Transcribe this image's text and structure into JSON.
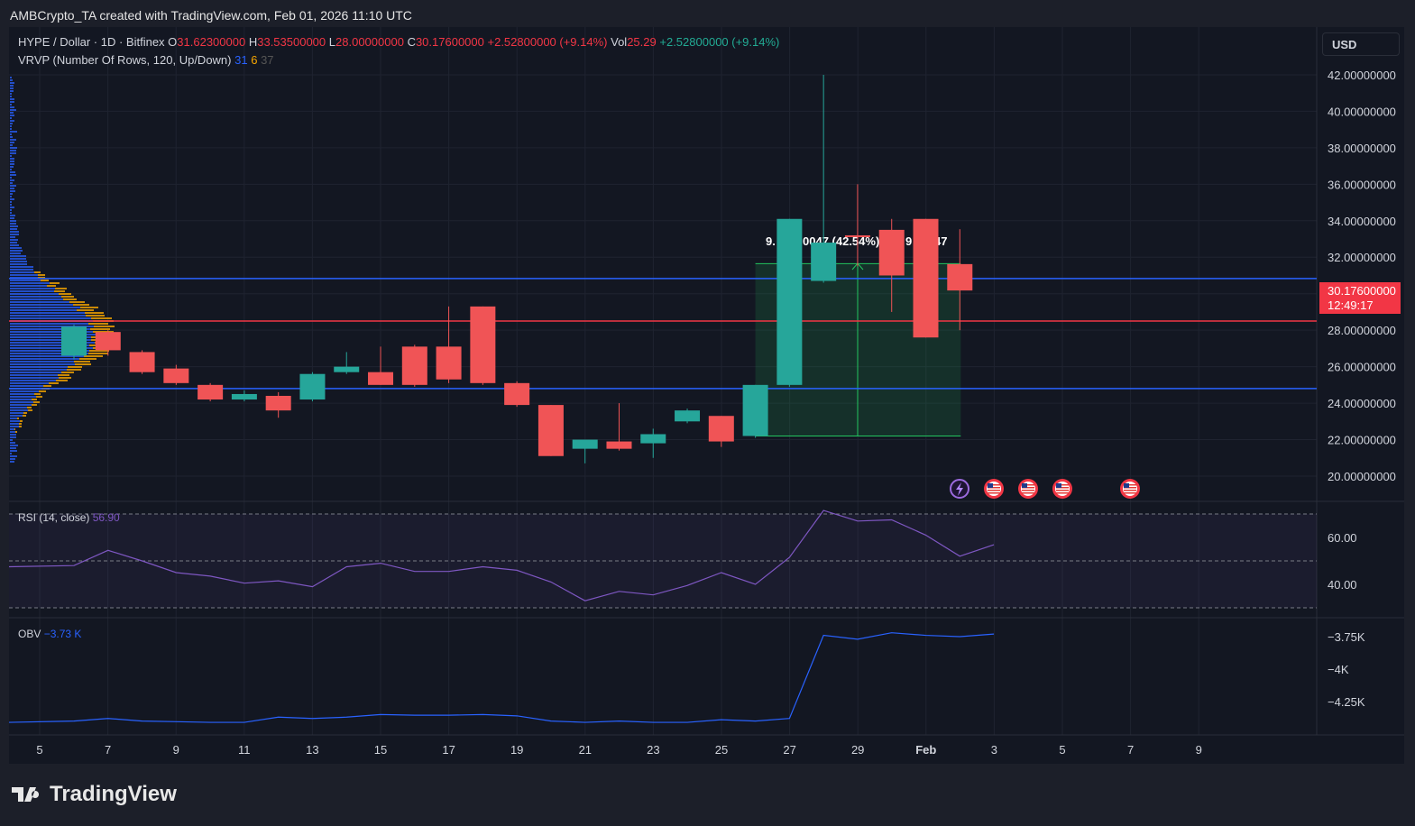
{
  "caption": "AMBCrypto_TA created with TradingView.com, Feb 01, 2026 11:10 UTC",
  "legend": {
    "symbol": "HYPE / Dollar · 1D · Bitfinex",
    "o_label": "O",
    "o": "31.62300000",
    "h_label": "H",
    "h": "33.53500000",
    "l_label": "L",
    "l": "28.00000000",
    "c_label": "C",
    "c": "30.17600000",
    "change": "+2.52800000 (+9.14%)",
    "vol_label": "Vol",
    "vol": "25.29",
    "vol_change": "+2.52800000 (+9.14%)",
    "vrvp": "VRVP (Number Of Rows, 120, Up/Down)",
    "vrvp_up": "31",
    "vrvp_down": "6",
    "vrvp_total": "37"
  },
  "currency_button": "USD",
  "last_price": {
    "price": "30.17600000",
    "countdown": "12:49:17"
  },
  "measure": {
    "label_a": "9.",
    "label_b": "0047 (42.54%)",
    "label_c": "9",
    "label_d": "47"
  },
  "colors": {
    "up": "#26a69a",
    "down": "#f05456",
    "rsi": "#7e57c2",
    "obv": "#2962ff",
    "hline_blue": "#2962ff",
    "hline_red": "#f23645",
    "measure": "#22c55e"
  },
  "chart_data": [
    {
      "type": "candlestick",
      "title": "HYPE / Dollar · 1D · Bitfinex",
      "ylim": [
        19,
        43
      ],
      "price_ticks": [
        "42.00000000",
        "40.00000000",
        "38.00000000",
        "36.00000000",
        "34.00000000",
        "32.00000000",
        "30.00000000",
        "28.00000000",
        "26.00000000",
        "24.00000000",
        "22.00000000",
        "20.00000000"
      ],
      "x_ticks": [
        "5",
        "7",
        "9",
        "11",
        "13",
        "15",
        "17",
        "19",
        "21",
        "23",
        "25",
        "27",
        "29",
        "Feb",
        "3",
        "5",
        "7",
        "9"
      ],
      "candles": [
        {
          "date": "Jan 6",
          "o": 26.6,
          "h": 28.3,
          "l": 26.4,
          "c": 28.2
        },
        {
          "date": "Jan 7",
          "o": 27.9,
          "h": 28.0,
          "l": 26.6,
          "c": 26.9
        },
        {
          "date": "Jan 8",
          "o": 26.8,
          "h": 26.9,
          "l": 25.6,
          "c": 25.7
        },
        {
          "date": "Jan 9",
          "o": 25.9,
          "h": 26.1,
          "l": 25.0,
          "c": 25.1
        },
        {
          "date": "Jan 10",
          "o": 25.0,
          "h": 25.1,
          "l": 24.1,
          "c": 24.2
        },
        {
          "date": "Jan 11",
          "o": 24.2,
          "h": 24.7,
          "l": 24.1,
          "c": 24.5
        },
        {
          "date": "Jan 12",
          "o": 24.4,
          "h": 24.6,
          "l": 23.2,
          "c": 23.6
        },
        {
          "date": "Jan 13",
          "o": 24.2,
          "h": 25.7,
          "l": 24.1,
          "c": 25.6
        },
        {
          "date": "Jan 14",
          "o": 25.7,
          "h": 26.8,
          "l": 25.6,
          "c": 26.0
        },
        {
          "date": "Jan 15",
          "o": 25.7,
          "h": 27.1,
          "l": 25.0,
          "c": 25.0
        },
        {
          "date": "Jan 16",
          "o": 27.1,
          "h": 27.2,
          "l": 24.9,
          "c": 25.0
        },
        {
          "date": "Jan 17",
          "o": 27.1,
          "h": 29.3,
          "l": 25.1,
          "c": 25.3
        },
        {
          "date": "Jan 18",
          "o": 29.3,
          "h": 29.3,
          "l": 25.0,
          "c": 25.1
        },
        {
          "date": "Jan 19",
          "o": 25.1,
          "h": 25.2,
          "l": 23.8,
          "c": 23.9
        },
        {
          "date": "Jan 20",
          "o": 23.9,
          "h": 23.9,
          "l": 21.1,
          "c": 21.1
        },
        {
          "date": "Jan 21",
          "o": 21.5,
          "h": 22.0,
          "l": 20.7,
          "c": 22.0
        },
        {
          "date": "Jan 22",
          "o": 21.9,
          "h": 24.0,
          "l": 21.4,
          "c": 21.5
        },
        {
          "date": "Jan 23",
          "o": 21.8,
          "h": 22.6,
          "l": 21.0,
          "c": 22.3
        },
        {
          "date": "Jan 24",
          "o": 23.0,
          "h": 23.7,
          "l": 22.9,
          "c": 23.6
        },
        {
          "date": "Jan 25",
          "o": 23.3,
          "h": 23.3,
          "l": 21.6,
          "c": 21.9
        },
        {
          "date": "Jan 26",
          "o": 22.2,
          "h": 25.0,
          "l": 22.1,
          "c": 25.0
        },
        {
          "date": "Jan 27",
          "o": 25.0,
          "h": 34.1,
          "l": 24.9,
          "c": 34.1
        },
        {
          "date": "Jan 28",
          "o": 30.7,
          "h": 42.0,
          "l": 30.6,
          "c": 32.8
        },
        {
          "date": "Jan 29",
          "o": 33.2,
          "h": 36.0,
          "l": 31.5,
          "c": 33.1
        },
        {
          "date": "Jan 30",
          "o": 33.5,
          "h": 34.1,
          "l": 29.0,
          "c": 31.0
        },
        {
          "date": "Jan 31",
          "o": 34.1,
          "h": 34.1,
          "l": 27.6,
          "c": 27.6
        },
        {
          "date": "Feb 1",
          "o": 31.623,
          "h": 33.535,
          "l": 28.0,
          "c": 30.176
        }
      ],
      "horizontal_lines": [
        30.83,
        28.5,
        24.8
      ],
      "measure_range": {
        "from": "Jan 26",
        "to": "Feb 1",
        "low": 22.2,
        "high": 31.65
      }
    },
    {
      "type": "line",
      "title": "RSI (14, close)",
      "value_label": "56.90",
      "ylim": [
        20,
        80
      ],
      "bands": [
        70,
        50,
        30
      ],
      "y_ticks": [
        "60.00",
        "40.00"
      ],
      "values": [
        47.5,
        48,
        54.5,
        50,
        45,
        43.5,
        40.5,
        41.5,
        39,
        47.5,
        49,
        45.5,
        45.5,
        47.5,
        46,
        41,
        33,
        37,
        35.5,
        39.5,
        45,
        40,
        51.5,
        71.5,
        67,
        67.5,
        61,
        52,
        56.9
      ]
    },
    {
      "type": "line",
      "title": "OBV",
      "value_label": "−3.73 K",
      "ylim": [
        -4.47,
        -3.62
      ],
      "y_ticks": [
        "−3.75K",
        "−4K",
        "−4.25K"
      ],
      "values": [
        -4.41,
        -4.4,
        -4.38,
        -4.4,
        -4.405,
        -4.41,
        -4.41,
        -4.37,
        -4.38,
        -4.37,
        -4.35,
        -4.355,
        -4.355,
        -4.35,
        -4.36,
        -4.4,
        -4.41,
        -4.4,
        -4.41,
        -4.41,
        -4.39,
        -4.4,
        -4.38,
        -3.74,
        -3.77,
        -3.72,
        -3.74,
        -3.75,
        -3.73
      ]
    }
  ],
  "events": [
    "lightning-icon",
    "us-flag-icon",
    "us-flag-icon",
    "us-flag-icon",
    "us-flag-icon"
  ],
  "brand": "TradingView"
}
